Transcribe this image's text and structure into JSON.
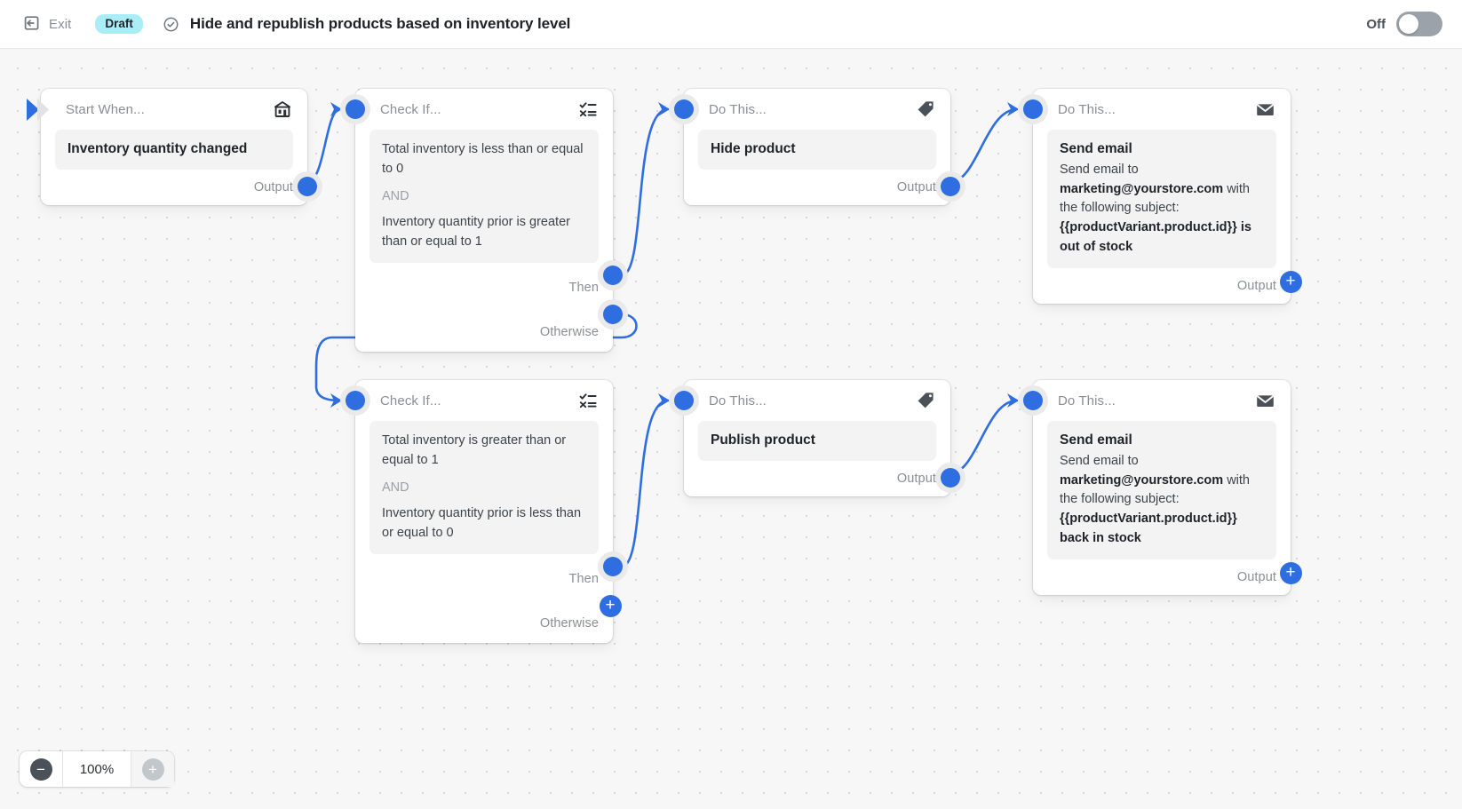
{
  "topbar": {
    "exit_label": "Exit",
    "status_badge": "Draft",
    "title": "Hide and republish products based on inventory level",
    "toggle_label": "Off",
    "toggle_state": "off",
    "back_icon": "exit-arrow-icon",
    "status_check_icon": "circle-check-icon"
  },
  "canvas": {
    "zoom": {
      "value": "100%",
      "zoom_out_label": "−",
      "zoom_in_label": "+"
    },
    "labels": {
      "output": "Output",
      "then": "Then",
      "otherwise": "Otherwise",
      "and": "AND",
      "plus": "+"
    }
  },
  "nodes": {
    "trigger": {
      "header": "Start When...",
      "icon": "store-icon",
      "body": "Inventory quantity changed",
      "output_label": "Output"
    },
    "condition_1": {
      "header": "Check If...",
      "icon": "condition-checklist-icon",
      "condition_a": "Total inventory is less than or equal to 0",
      "operator": "AND",
      "condition_b": "Inventory quantity prior is greater than or equal to 1",
      "then_label": "Then",
      "otherwise_label": "Otherwise"
    },
    "action_hide": {
      "header": "Do This...",
      "icon": "tag-icon",
      "body": "Hide product",
      "output_label": "Output"
    },
    "action_email_out_of_stock": {
      "header": "Do This...",
      "icon": "envelope-icon",
      "title": "Send email",
      "desc_part_1": "Send email to ",
      "recipient": "marketing@yourstore.com",
      "desc_part_2": " with the following subject: ",
      "subject": "{{productVariant.product.id}} is out of stock",
      "output_label": "Output"
    },
    "condition_2": {
      "header": "Check If...",
      "icon": "condition-checklist-icon",
      "condition_a": "Total inventory is greater than or equal to 1",
      "operator": "AND",
      "condition_b": "Inventory quantity prior is less than or equal to 0",
      "then_label": "Then",
      "otherwise_label": "Otherwise"
    },
    "action_publish": {
      "header": "Do This...",
      "icon": "tag-icon",
      "body": "Publish product",
      "output_label": "Output"
    },
    "action_email_back_in_stock": {
      "header": "Do This...",
      "icon": "envelope-icon",
      "title": "Send email",
      "desc_part_1": "Send email to ",
      "recipient": "marketing@yourstore.com",
      "desc_part_2": " with the following subject: ",
      "subject": "{{productVariant.product.id}} back in stock",
      "output_label": "Output"
    }
  },
  "colors": {
    "accent_blue": "#2f6ee0",
    "draft_badge_bg": "#a9edf6",
    "canvas_bg": "#f7f7f7",
    "muted_text": "#8a8f94"
  }
}
